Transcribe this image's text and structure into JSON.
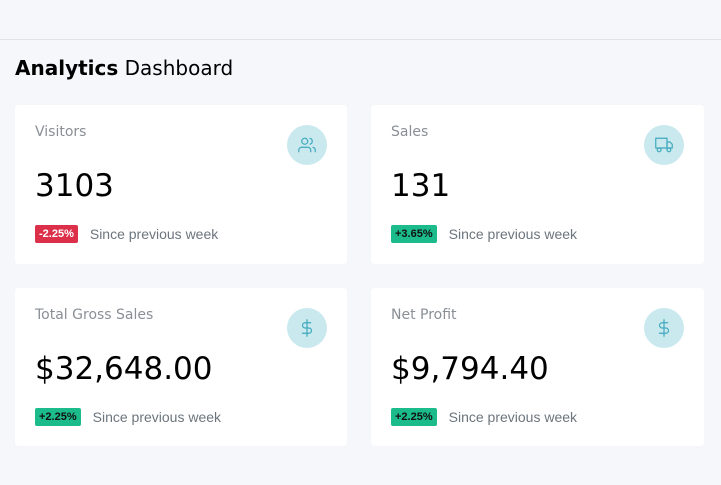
{
  "page": {
    "title_strong": "Analytics",
    "title_light": "Dashboard"
  },
  "cards": [
    {
      "title": "Visitors",
      "value": "3103",
      "change": "-2.25%",
      "change_direction": "down",
      "since": "Since previous week",
      "icon": "users-icon"
    },
    {
      "title": "Sales",
      "value": "131",
      "change": "+3.65%",
      "change_direction": "up",
      "since": "Since previous week",
      "icon": "truck-icon"
    },
    {
      "title": "Total Gross Sales",
      "value": "$32,648.00",
      "change": "+2.25%",
      "change_direction": "up",
      "since": "Since previous week",
      "icon": "dollar-icon"
    },
    {
      "title": "Net Profit",
      "value": "$9,794.40",
      "change": "+2.25%",
      "change_direction": "up",
      "since": "Since previous week",
      "icon": "dollar-icon"
    }
  ],
  "colors": {
    "icon_bg": "#c9e9ee",
    "icon_stroke": "#3fa9bd",
    "badge_down": "#dc2f4a",
    "badge_up": "#1cbb8c"
  }
}
